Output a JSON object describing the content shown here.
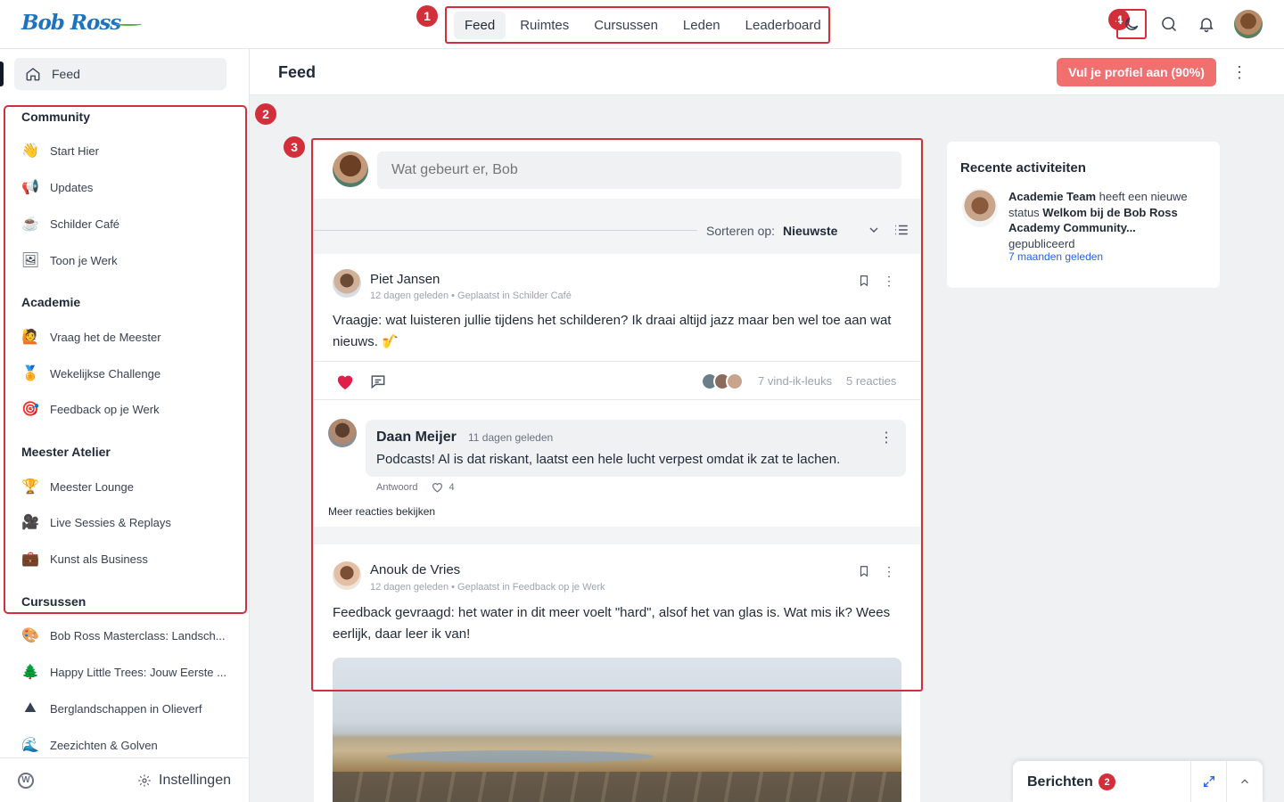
{
  "app": {
    "logo": "Bob Ross"
  },
  "topnav": {
    "items": [
      "Feed",
      "Ruimtes",
      "Cursussen",
      "Leden",
      "Leaderboard"
    ],
    "active": "Feed"
  },
  "markers": [
    "1",
    "2",
    "3",
    "4"
  ],
  "sidebar": {
    "feed_label": "Feed",
    "groups": [
      {
        "title": "Community",
        "items": [
          {
            "label": "Start Hier",
            "icon": "👋"
          },
          {
            "label": "Updates",
            "icon": "📢"
          },
          {
            "label": "Schilder Café",
            "icon": "☕"
          },
          {
            "label": "Toon je Werk",
            "icon": "🖼"
          }
        ]
      },
      {
        "title": "Academie",
        "items": [
          {
            "label": "Vraag het de Meester",
            "icon": "🙋"
          },
          {
            "label": "Wekelijkse Challenge",
            "icon": "🏅"
          },
          {
            "label": "Feedback op je Werk",
            "icon": "🎯"
          }
        ]
      },
      {
        "title": "Meester Atelier",
        "items": [
          {
            "label": "Meester Lounge",
            "icon": "🏆"
          },
          {
            "label": "Live Sessies & Replays",
            "icon": "🎥"
          },
          {
            "label": "Kunst als Business",
            "icon": "💼"
          }
        ]
      },
      {
        "title": "Cursussen",
        "items": [
          {
            "label": "Bob Ross Masterclass: Landsch...",
            "icon": "🎨"
          },
          {
            "label": "Happy Little Trees: Jouw Eerste ...",
            "icon": "🌲"
          },
          {
            "label": "Berglandschappen in Olieverf",
            "icon": "⛰"
          },
          {
            "label": "Zeezichten & Golven",
            "icon": "🌊"
          }
        ]
      }
    ],
    "footer": {
      "wp": "W",
      "settings_label": "Instellingen"
    }
  },
  "header": {
    "title": "Feed",
    "profile_button": "Vul je profiel aan (90%)"
  },
  "composer": {
    "placeholder": "Wat gebeurt er, Bob"
  },
  "sort": {
    "label": "Sorteren op:",
    "value": "Nieuwste"
  },
  "posts": [
    {
      "author": "Piet Jansen",
      "meta": "12 dagen geleden • Geplaatst in Schilder Café",
      "body": "Vraagje: wat luisteren jullie tijdens het schilderen? Ik draai altijd jazz maar ben wel toe aan wat nieuws. 🎷",
      "likes": "7 vind-ik-leuks",
      "reactions": "5 reacties",
      "comment": {
        "author": "Daan Meijer",
        "time": "11 dagen geleden",
        "text": "Podcasts! Al is dat riskant, laatst een hele lucht verpest omdat ik zat te lachen.",
        "reply": "Antwoord",
        "likes": "4"
      },
      "more_comments": "Meer reacties bekijken"
    },
    {
      "author": "Anouk de Vries",
      "meta": "12 dagen geleden • Geplaatst in Feedback op je Werk",
      "body": "Feedback gevraagd: het water in dit meer voelt \"hard\", alsof het van glas is. Wat mis ik? Wees eerlijk, daar leer ik van!"
    }
  ],
  "activity": {
    "title": "Recente activiteiten",
    "actor": "Academie Team",
    "text1": " heeft een nieuwe status ",
    "status": "Welkom bij de Bob Ross Academy Community...",
    "text2": " gepubliceerd",
    "time": "7 maanden geleden"
  },
  "messages": {
    "label": "Berichten",
    "count": "2"
  },
  "colors": {
    "accent_red": "#d32f3a",
    "profile_button": "#f07070",
    "link_blue": "#2563eb",
    "logo_blue": "#1e73be"
  }
}
